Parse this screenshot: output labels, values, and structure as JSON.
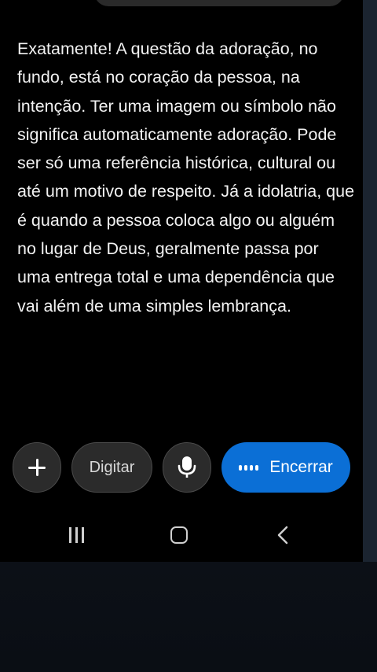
{
  "chat": {
    "message": "Exatamente! A questão da adoração, no fundo, está no coração da pessoa, na intenção. Ter uma imagem ou símbolo não significa automaticamente adoração. Pode ser só uma referência histórica, cultural ou até um motivo de respeito. Já a idolatria, que é quando a pessoa coloca algo ou alguém no lugar de Deus, geralmente passa por uma entrega total e uma dependência que vai além de uma simples lembrança."
  },
  "controls": {
    "add_icon": "plus-icon",
    "type_label": "Digitar",
    "mic_icon": "microphone-icon",
    "end_label": "Encerrar",
    "end_icon": "voice-wave-icon",
    "accent_color": "#0b6fd6"
  },
  "navbar": {
    "recent_icon": "recent-apps-icon",
    "home_icon": "home-icon",
    "back_icon": "back-icon"
  }
}
